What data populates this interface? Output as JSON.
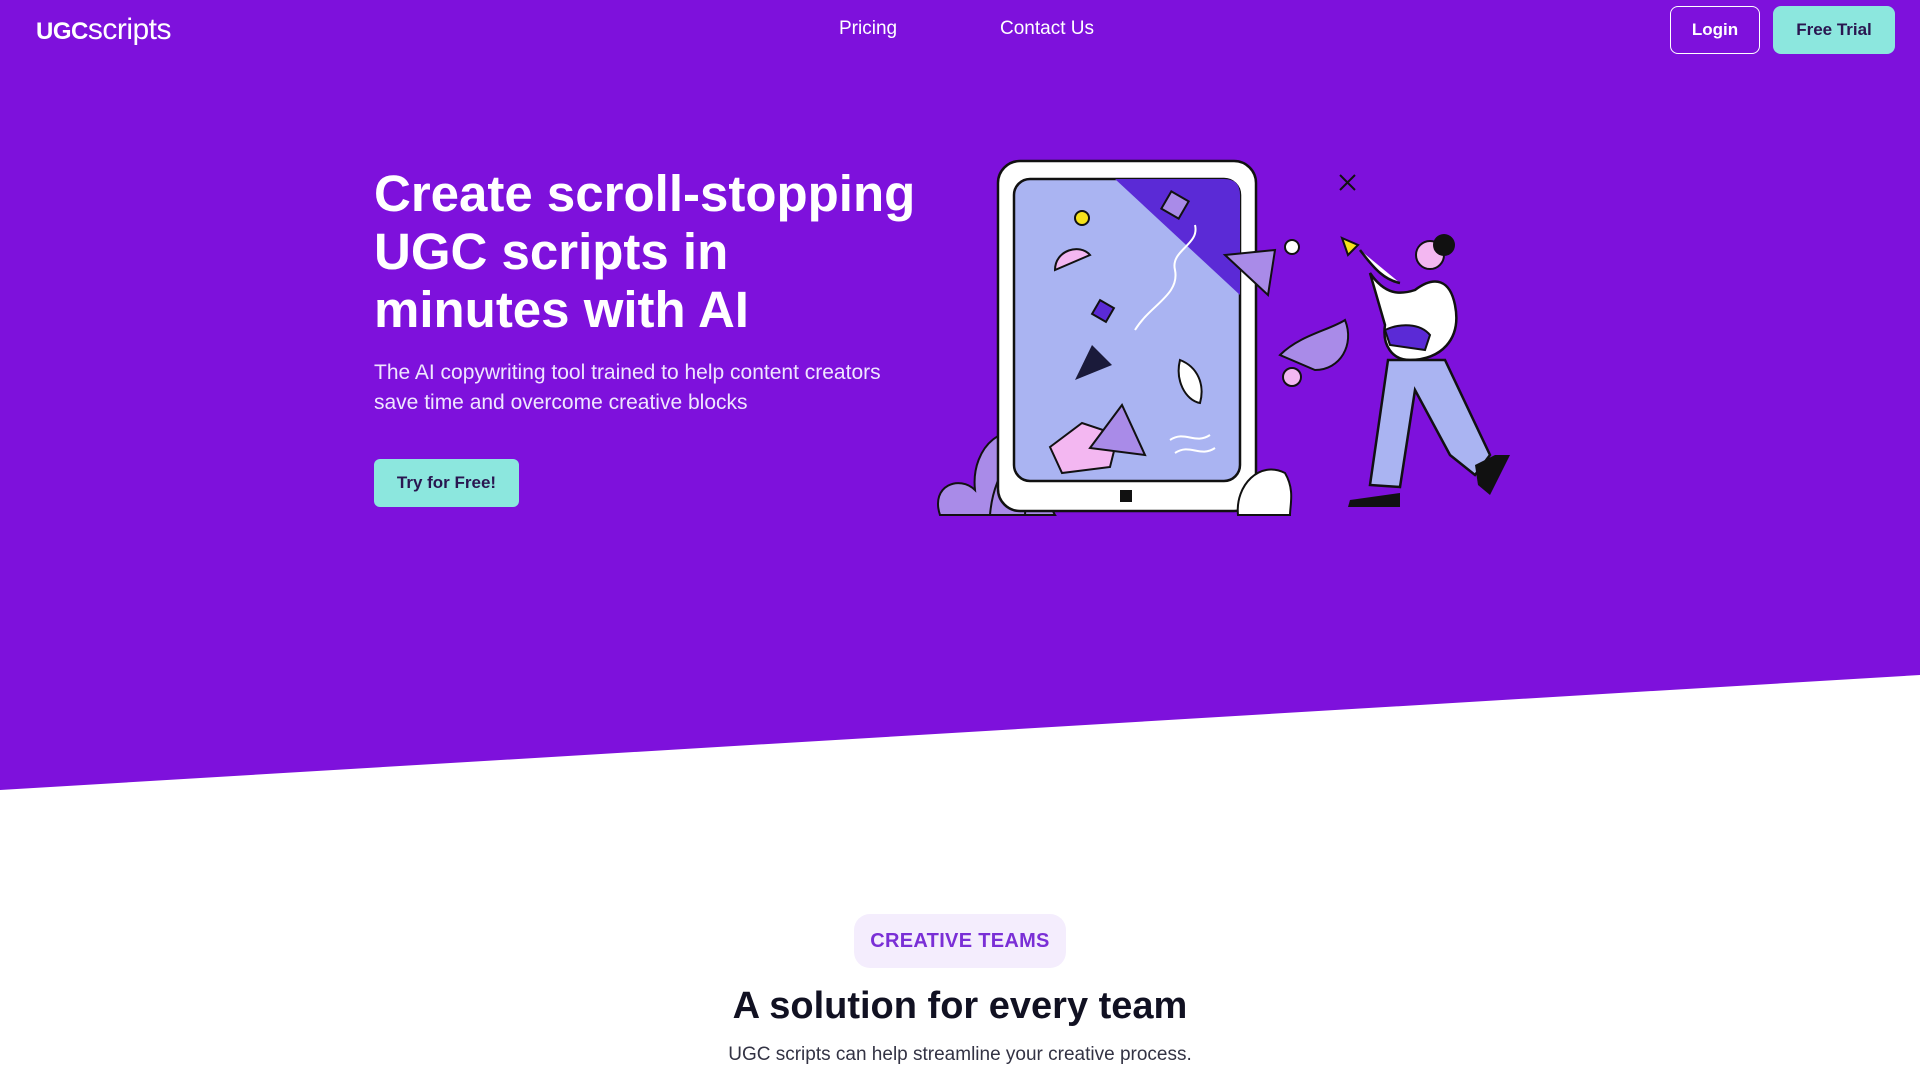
{
  "colors": {
    "hero_background": "#7e11dc",
    "accent_button": "#8ce7de",
    "badge_background": "#f4edfd",
    "badge_text": "#7a2fd6"
  },
  "nav": {
    "logo_strong": "UGC",
    "logo_light": "scripts",
    "links": [
      {
        "label": "Pricing"
      },
      {
        "label": "Contact Us"
      }
    ],
    "login_label": "Login",
    "trial_label": "Free Trial"
  },
  "hero": {
    "title": "Create scroll-stopping UGC scripts in minutes with AI",
    "subtitle": "The AI copywriting tool trained to help content creators save time and overcome creative blocks",
    "cta_label": "Try for Free!",
    "illustration_icon": "tablet-creator-illustration"
  },
  "section": {
    "badge": "CREATIVE TEAMS",
    "title": "A solution for every team",
    "subtitle": "UGC scripts can help streamline your creative process."
  }
}
